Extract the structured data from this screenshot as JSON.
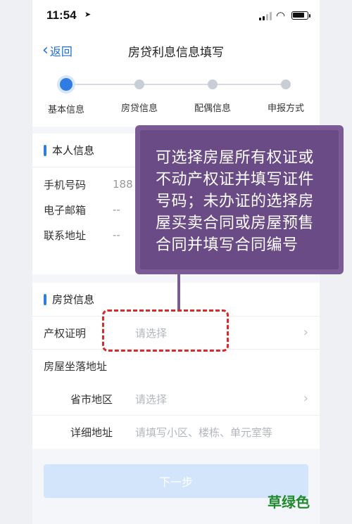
{
  "status_bar": {
    "time": "11:54",
    "location_glyph": "➤"
  },
  "nav": {
    "back_label": "返回",
    "title": "房贷利息信息填写"
  },
  "steps": [
    {
      "label": "基本信息",
      "active": true
    },
    {
      "label": "房贷信息",
      "active": false
    },
    {
      "label": "配偶信息",
      "active": false
    },
    {
      "label": "申报方式",
      "active": false
    }
  ],
  "personal": {
    "title": "本人信息",
    "rows": [
      {
        "key": "手机号码",
        "value": "188"
      },
      {
        "key": "电子邮箱",
        "value": "--"
      },
      {
        "key": "联系地址",
        "value": "--"
      }
    ]
  },
  "loan": {
    "title": "房贷信息",
    "property_cert": {
      "key": "产权证明",
      "placeholder": "请选择"
    },
    "address_label": "房屋坐落地址",
    "region": {
      "key": "省市地区",
      "placeholder": "请选择"
    },
    "detail": {
      "key": "详细地址",
      "placeholder": "请填写小区、楼栋、单元室等"
    }
  },
  "next_button": "下一步",
  "callout_text": "可选择房屋所有权证或不动产权证并填写证件号码；未办证的选择房屋买卖合同或房屋预售合同并填写合同编号",
  "watermark": "草绿色",
  "colors": {
    "accent": "#2f7de2",
    "callout": "#6b4b86",
    "dashed_box": "#d42c2c",
    "watermark": "#1f8a2e"
  }
}
